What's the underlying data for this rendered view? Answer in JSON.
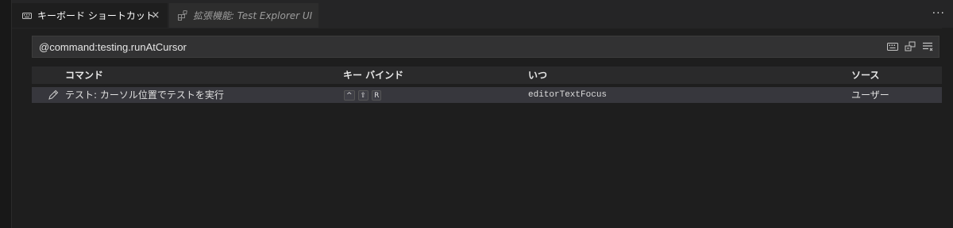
{
  "tabs": [
    {
      "label": "キーボード ショートカット",
      "icon": "keyboard-icon",
      "active": true,
      "close": "×"
    },
    {
      "label": "拡張機能: Test Explorer UI",
      "icon": "extensions-icon",
      "active": false
    }
  ],
  "more_actions": "···",
  "search": {
    "value": "@command:testing.runAtCursor",
    "actions": [
      "record-keys-icon",
      "sort-by-precedence-icon",
      "clear-input-icon"
    ]
  },
  "table": {
    "headers": {
      "command": "コマンド",
      "keybinding": "キー バインド",
      "when": "いつ",
      "source": "ソース"
    },
    "rows": [
      {
        "command": "テスト: カーソル位置でテストを実行",
        "keys": [
          "^",
          "⇧",
          "R"
        ],
        "when": "editorTextFocus",
        "source": "ユーザー"
      }
    ]
  }
}
